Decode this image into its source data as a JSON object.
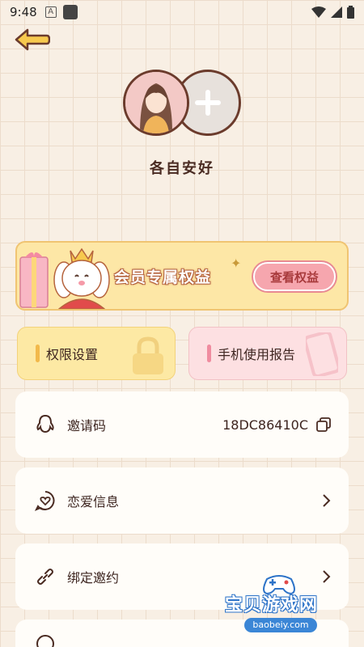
{
  "status_bar": {
    "time": "9:48",
    "a_icon": "A"
  },
  "profile": {
    "nickname": "各自安好"
  },
  "vip": {
    "title": "会员专属权益",
    "button": "查看权益"
  },
  "tiles": {
    "permissions": "权限设置",
    "usage_report": "手机使用报告"
  },
  "rows": [
    {
      "label": "邀请码",
      "value": "18DC86410C",
      "icon": "qq-icon"
    },
    {
      "label": "恋爱信息",
      "icon": "heart-bubble-icon"
    },
    {
      "label": "绑定邀约",
      "icon": "link-icon"
    }
  ],
  "watermark": {
    "text": "宝贝游戏网",
    "url": "baobeiy.com"
  },
  "colors": {
    "background": "#f8efe4",
    "accent": "#f2b94b",
    "pink": "#f6a6ae",
    "text": "#3d2520"
  }
}
